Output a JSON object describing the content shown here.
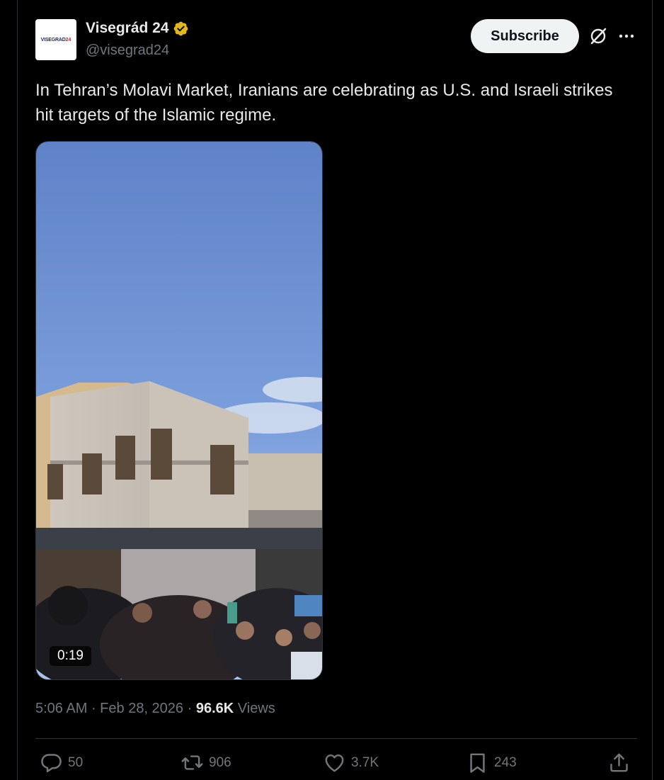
{
  "author": {
    "display_name": "Visegrád 24",
    "handle": "@visegrad24",
    "avatar_text_a": "VISEGRAD",
    "avatar_text_b": "24",
    "verified_color": "#e2b719"
  },
  "header": {
    "subscribe_label": "Subscribe"
  },
  "tweet": {
    "text": "In Tehran’s Molavi Market, Iranians are celebrating as U.S. and Israeli strikes hit targets of the Islamic regime."
  },
  "media": {
    "duration": "0:19"
  },
  "meta": {
    "time": "5:06 AM",
    "separator": " · ",
    "date": "Feb 28, 2026",
    "views_count": "96.6K",
    "views_label": "Views"
  },
  "actions": {
    "replies": "50",
    "reposts": "906",
    "likes": "3.7K",
    "bookmarks": "243"
  },
  "icons": {
    "verified": "verified-badge-icon",
    "grok": "grok-icon",
    "more": "more-icon",
    "reply": "reply-icon",
    "repost": "repost-icon",
    "like": "like-icon",
    "bookmark": "bookmark-icon",
    "share": "share-icon"
  },
  "colors": {
    "background": "#000000",
    "text": "#e7e9ea",
    "muted": "#71767b",
    "border": "#2f3336",
    "subscribe_bg": "#eff3f4"
  }
}
